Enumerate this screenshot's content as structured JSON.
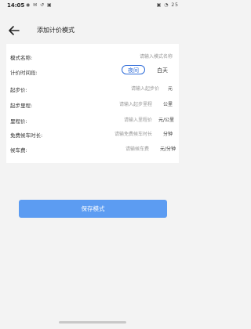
{
  "status_bar": {
    "time": "14:05",
    "left_icons": "◉ ✉ ↺ ▣",
    "right_icons": "▣ ◔ 25"
  },
  "header": {
    "title": "添加计价模式"
  },
  "form": {
    "mode_name": {
      "label": "模式名称:",
      "placeholder": "请输入模式名称"
    },
    "period": {
      "label": "计价时间段:",
      "night": "夜间",
      "day": "白天"
    },
    "start_price": {
      "label": "起步价:",
      "placeholder": "请输入起步价",
      "unit": "元"
    },
    "start_distance": {
      "label": "起步里程:",
      "placeholder": "请输入起步里程",
      "unit": "公里"
    },
    "distance_price": {
      "label": "里程价:",
      "placeholder": "请输入里程价",
      "unit": "元/公里"
    },
    "free_wait": {
      "label": "免费候车时长:",
      "placeholder": "请输免费候车时长",
      "unit": "分钟"
    },
    "wait_fee": {
      "label": "候车费:",
      "placeholder": "请输候车费",
      "unit": "元/分钟"
    }
  },
  "actions": {
    "save_label": "保存模式"
  }
}
